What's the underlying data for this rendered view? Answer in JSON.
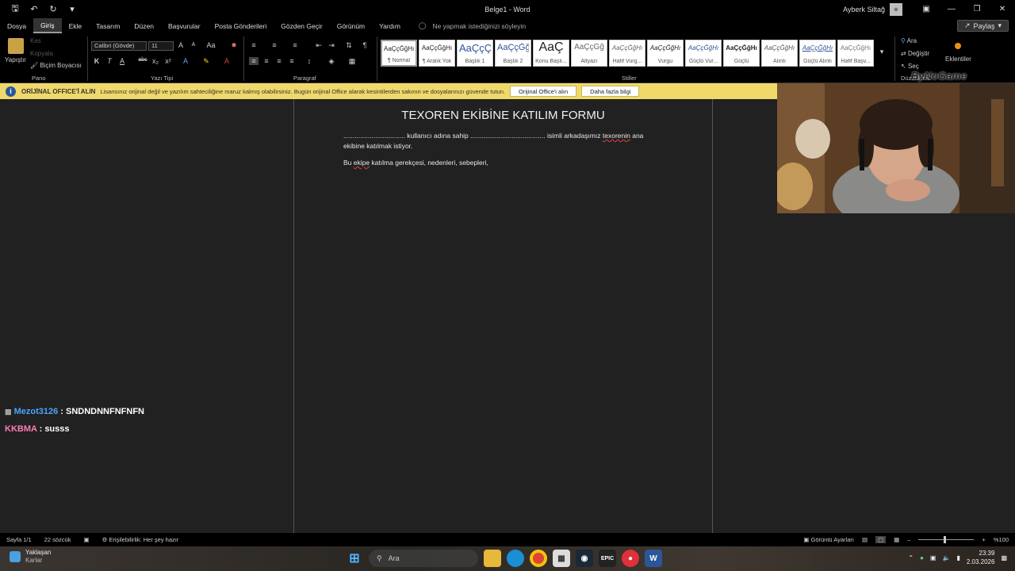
{
  "titlebar": {
    "doc_title": "Belge1  -  Word",
    "user": "Ayberk Siltağ",
    "share": "Paylaş"
  },
  "menu": {
    "items": [
      "Dosya",
      "Giriş",
      "Ekle",
      "Tasarım",
      "Düzen",
      "Başvurular",
      "Posta Gönderileri",
      "Gözden Geçir",
      "Görünüm",
      "Yardım"
    ],
    "tellme": "Ne yapmak istediğinizi söyleyin"
  },
  "ribbon": {
    "paste": "Yapıştır",
    "cut": "Kes",
    "copy": "Kopyala",
    "format_painter": "Biçim Boyacısı",
    "font_name": "Calibri (Gövde)",
    "font_size": "11",
    "groups": {
      "clipboard": "Pano",
      "font": "Yazı Tipi",
      "paragraph": "Paragraf",
      "styles": "Stiller",
      "editing": "Düzenleme"
    },
    "styles": [
      {
        "sample": "AaÇçĞğHı",
        "name": "¶ Normal"
      },
      {
        "sample": "AaÇçĞğHı",
        "name": "¶ Aralık Yok"
      },
      {
        "sample": "AaÇçÇ",
        "name": "Başlık 1"
      },
      {
        "sample": "AaÇçĞğ",
        "name": "Başlık 2"
      },
      {
        "sample": "AaÇ",
        "name": "Konu Başlı..."
      },
      {
        "sample": "AaÇçĞğ",
        "name": "Altyazı"
      },
      {
        "sample": "AaÇçĞğHı",
        "name": "Hafif Vurg..."
      },
      {
        "sample": "AaÇçĞğHı",
        "name": "Vurgu"
      },
      {
        "sample": "AaÇçĞğHı",
        "name": "Güçlü Vur..."
      },
      {
        "sample": "AaÇçĞğHı",
        "name": "Güçlü"
      },
      {
        "sample": "AaÇçĞğHı",
        "name": "Alıntı"
      },
      {
        "sample": "AaÇçĞğHı",
        "name": "Güçlü Alıntı"
      },
      {
        "sample": "AaÇçĞğHı",
        "name": "Hafif Başv..."
      }
    ],
    "find": "Ara",
    "replace": "Değiştir",
    "select": "Seç",
    "addins": "Eklentiler"
  },
  "watermark": "ByNoGame",
  "infobar": {
    "title": "ORİJİNAL OFFICE'İ ALIN",
    "message": "Lisansınız orijinal değil ve yazılım sahteciliğine maruz kalmış olabilirsiniz. Bugün orijinal Office alarak kesintilerden sakının ve dosyalarınızı güvende tutun.",
    "btn_get": "Orijinal Office'i alın",
    "btn_more": "Daha fazla bilgi"
  },
  "document": {
    "title": "TEXOREN EKİBİNE KATILIM FORMU",
    "line1_a": "................................. kullanıcı adına sahip ........................................ isimli arkadaşımız ",
    "line1_word": "texorenin",
    "line1_b": " ana",
    "line2": "ekibine katılmak istiyor.",
    "line3_a": "Bu ",
    "line3_word": "ekipe",
    "line3_b": " katılma gerekçesi, nedenleri, sebepleri,"
  },
  "chat": [
    {
      "user": "Mezot3126",
      "sep": " : ",
      "message": "SNDNDNNFNFNFN"
    },
    {
      "user": "KKBMA",
      "sep": " : ",
      "message": "susss"
    }
  ],
  "statusbar": {
    "page": "Sayfa 1/1",
    "words": "22 sözcük",
    "accessibility": "Erişilebilirlik: Her şey hazır",
    "focus": "Görüntü Ayarları",
    "zoom": "%100"
  },
  "taskbar": {
    "weather_title": "Yaklaşan",
    "weather_sub": "Karlar",
    "search": "Ara",
    "time": "23:39",
    "date": "2.03.2026"
  }
}
